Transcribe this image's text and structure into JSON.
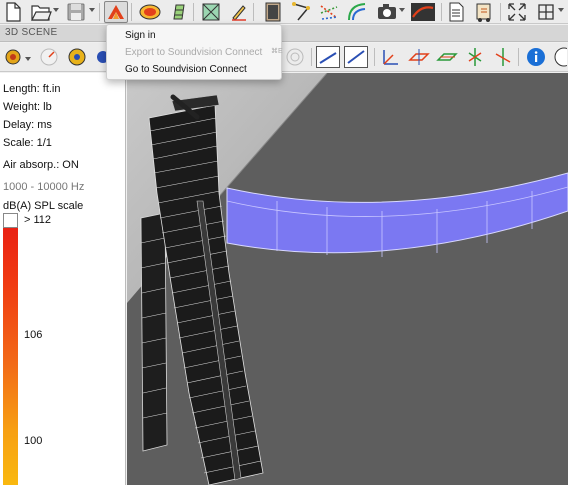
{
  "window": {
    "scene_title": "3D SCENE"
  },
  "toolbar": {
    "icons": [
      "new-file-icon",
      "open-folder-icon",
      "save-icon",
      "soundvision-connect-icon",
      "spl-mapping-icon",
      "audience-surface-icon",
      "frame-icon",
      "pencil-icon",
      "speaker-icon",
      "rigging-icon",
      "laser-icon",
      "plot-icon",
      "camera-icon",
      "acoustic-icon",
      "report-icon",
      "export-icon",
      "expand-icon",
      "grid-icon"
    ]
  },
  "dropdown_menu": {
    "items": [
      {
        "label": "Sign in",
        "enabled": true
      },
      {
        "label": "Export to Soundvision Connect",
        "enabled": false,
        "shortcut": "⌘E"
      },
      {
        "label": "Go to Soundvision Connect",
        "enabled": true
      }
    ]
  },
  "left_panel": {
    "length": "Length: ft.in",
    "weight": "Weight: lb",
    "delay": "Delay: ms",
    "scale": "Scale: 1/1",
    "air_absorption": "Air absorp.: ON",
    "frequency_range": "1000 - 10000 Hz",
    "spl_scale_title": "dB(A) SPL scale",
    "spl_scale_labels": [
      "> 112",
      "106",
      "100"
    ]
  },
  "colors": {
    "audience_surface": "#7b78f2",
    "viewport_background": "#5e5e5e",
    "scale_top": "#e81c14",
    "scale_bottom": "#f9b80f"
  }
}
